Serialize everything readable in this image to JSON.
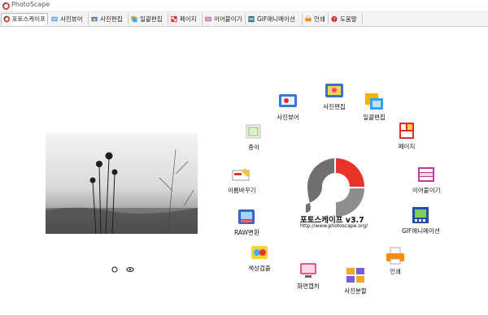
{
  "window": {
    "title": "PhotoScape"
  },
  "tabs": [
    {
      "label": "포토스케이프",
      "icon": "photoscape-logo-icon",
      "active": true
    },
    {
      "label": "사진뷰어",
      "icon": "viewer-icon"
    },
    {
      "label": "사진편집",
      "icon": "editor-icon"
    },
    {
      "label": "일괄편집",
      "icon": "batch-editor-icon"
    },
    {
      "label": "페이지",
      "icon": "page-icon"
    },
    {
      "label": "이어붙이기",
      "icon": "combine-icon"
    },
    {
      "label": "GIF애니메이션",
      "icon": "gif-animation-icon"
    },
    {
      "label": "인쇄",
      "icon": "print-icon"
    },
    {
      "label": "도움말",
      "icon": "help-icon"
    }
  ],
  "menu": [
    {
      "label": "사진편집",
      "icon": "editor-icon"
    },
    {
      "label": "일괄편집",
      "icon": "batch-editor-icon"
    },
    {
      "label": "페이지",
      "icon": "page-icon"
    },
    {
      "label": "이어붙이기",
      "icon": "combine-icon"
    },
    {
      "label": "GIF애니메이션",
      "icon": "gif-animation-icon"
    },
    {
      "label": "인쇄",
      "icon": "print-icon"
    },
    {
      "label": "사진분할",
      "icon": "splitter-icon"
    },
    {
      "label": "화면캡처",
      "icon": "screen-capture-icon"
    },
    {
      "label": "색상검출",
      "icon": "color-picker-icon"
    },
    {
      "label": "RAW변환",
      "icon": "raw-converter-icon"
    },
    {
      "label": "이름바꾸기",
      "icon": "rename-icon"
    },
    {
      "label": "종이",
      "icon": "paper-print-icon"
    },
    {
      "label": "사진뷰어",
      "icon": "viewer-icon"
    }
  ],
  "brand": {
    "title": "포토스케이프 v3.7",
    "url": "http://www.photoscape.org/"
  },
  "colors": {
    "accent_red": "#e8332a",
    "ring_gray": "#8e8e8e"
  }
}
